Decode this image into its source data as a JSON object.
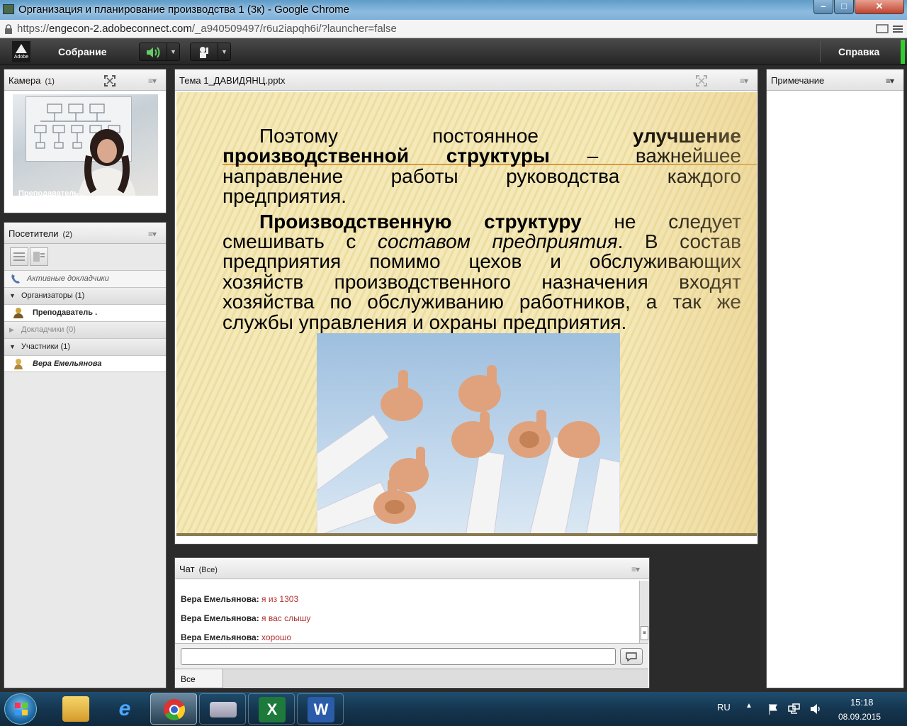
{
  "window": {
    "title": "Организация и планирование производства 1 (3к) - Google Chrome",
    "minimize": "–",
    "maximize": "□",
    "close": "✕"
  },
  "address": {
    "scheme": "https://",
    "host": "engecon-2.adobeconnect.com",
    "path": "/_a940509497/r6u2iapqh6i/?launcher=false"
  },
  "connect_bar": {
    "logo_text": "Adobe",
    "meeting_menu": "Собрание",
    "help_menu": "Справка",
    "speaker_status": "on"
  },
  "camera_pod": {
    "title": "Камера",
    "count": "(1)",
    "presenter_label": "Преподаватель ."
  },
  "attendees_pod": {
    "title": "Посетители",
    "count": "(2)",
    "active_speakers": "Активные докладчики",
    "groups": [
      {
        "label": "Организаторы (1)",
        "expanded": true,
        "members": [
          "Преподаватель ."
        ]
      },
      {
        "label": "Докладчики (0)",
        "expanded": false,
        "members": []
      },
      {
        "label": "Участники (1)",
        "expanded": true,
        "members": [
          "Вера Емельянова"
        ]
      }
    ]
  },
  "share_pod": {
    "title": "Тема 1_ДАВИДЯНЦ.pptx",
    "slide": {
      "line1_normal": "Поэтому постоянное ",
      "line1_bold": "улучшение",
      "line2_bold": "производственной структуры",
      "line2_normal": " – важнейшее",
      "line3": "направление работы руководства каждого",
      "line4": "предприятия.",
      "line5_bold": "Производственную структуру",
      "line5_normal": " не следует",
      "line6_normal": "смешивать с ",
      "line6_italic": "составом предприятия",
      "line6_end": ". В состав",
      "line7": "предприятия помимо цехов и обслуживающих",
      "line8": "хозяйств производственного назначения входят",
      "line9": "хозяйства по обслуживанию работников, а так же",
      "line10": "службы управления и охраны предприятия."
    }
  },
  "note_pod": {
    "title": "Примечание"
  },
  "chat_pod": {
    "title": "Чат",
    "scope": "(Все)",
    "messages": [
      {
        "sender": "Вера Емельянова:",
        "text": "я из 1303"
      },
      {
        "sender": "Вера Емельянова:",
        "text": "я вас слышу"
      },
      {
        "sender": "Вера Емельянова:",
        "text": "хорошо"
      }
    ],
    "input_value": "",
    "tab": "Все"
  },
  "taskbar": {
    "apps": [
      "windows-explorer",
      "internet-explorer",
      "google-chrome",
      "on-screen-keyboard",
      "microsoft-excel",
      "microsoft-word"
    ],
    "active_app": "google-chrome",
    "language": "RU",
    "time": "15:18",
    "date": "08.09.2015"
  }
}
